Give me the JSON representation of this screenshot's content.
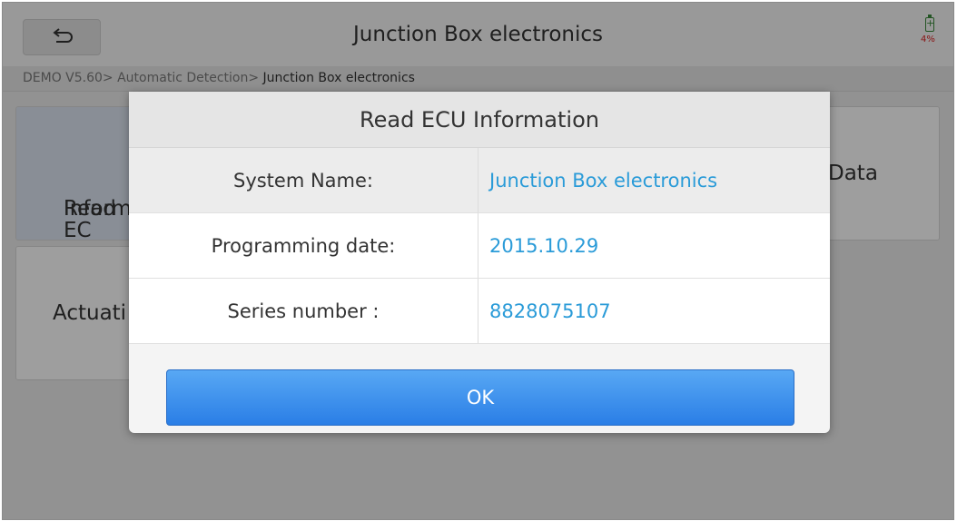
{
  "header": {
    "title": "Junction Box electronics",
    "battery_percent": "4%"
  },
  "breadcrumb": {
    "path": "DEMO V5.60> Automatic Detection> ",
    "current": "Junction Box electronics"
  },
  "tiles": {
    "read_ecu_line1": "Read EC",
    "read_ecu_line2": "Informat",
    "live_data": "Data",
    "actuation": "Actuati"
  },
  "dialog": {
    "title": "Read ECU Information",
    "rows": [
      {
        "label": "System Name:",
        "value": "Junction Box electronics"
      },
      {
        "label": "Programming date:",
        "value": "2015.10.29"
      },
      {
        "label": "Series number :",
        "value": "8828075107"
      }
    ],
    "ok_label": "OK"
  }
}
